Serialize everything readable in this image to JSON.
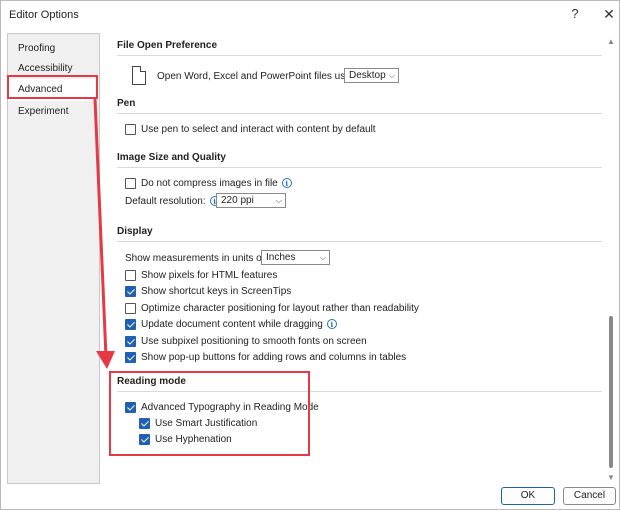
{
  "window": {
    "title": "Editor Options",
    "help_glyph": "?",
    "close_glyph": "✕"
  },
  "nav": {
    "items": [
      {
        "label": "Proofing",
        "selected": false
      },
      {
        "label": "Accessibility",
        "selected": false
      },
      {
        "label": "Advanced",
        "selected": true
      },
      {
        "label": "Experiment",
        "selected": false
      }
    ]
  },
  "sections": {
    "file_open": {
      "header": "File Open Preference",
      "label": "Open Word, Excel and PowerPoint files using:",
      "dropdown_value": "Desktop"
    },
    "pen": {
      "header": "Pen",
      "checkbox_label": "Use pen to select and interact with content by default",
      "checked": false
    },
    "image": {
      "header": "Image Size and Quality",
      "compress_label": "Do not compress images in file",
      "compress_checked": false,
      "resolution_label": "Default resolution:",
      "resolution_value": "220 ppi"
    },
    "display": {
      "header": "Display",
      "units_label": "Show measurements in units of:",
      "units_value": "Inches",
      "options": [
        {
          "label": "Show pixels for HTML features",
          "checked": false
        },
        {
          "label": "Show shortcut keys in ScreenTips",
          "checked": true
        },
        {
          "label": "Optimize character positioning for layout rather than readability",
          "checked": false
        },
        {
          "label": "Update document content while dragging",
          "checked": true
        },
        {
          "label": "Use subpixel positioning to smooth fonts on screen",
          "checked": true
        },
        {
          "label": "Show pop-up buttons for adding rows and columns in tables",
          "checked": true
        }
      ]
    },
    "reading": {
      "header": "Reading mode",
      "options": [
        {
          "label": "Advanced Typography in Reading Mode",
          "checked": true
        },
        {
          "label": "Use Smart Justification",
          "checked": true
        },
        {
          "label": "Use Hyphenation",
          "checked": true
        }
      ]
    }
  },
  "buttons": {
    "ok": "OK",
    "cancel": "Cancel"
  },
  "annotation_color": "#e63946",
  "accent_color": "#1f5fb4"
}
